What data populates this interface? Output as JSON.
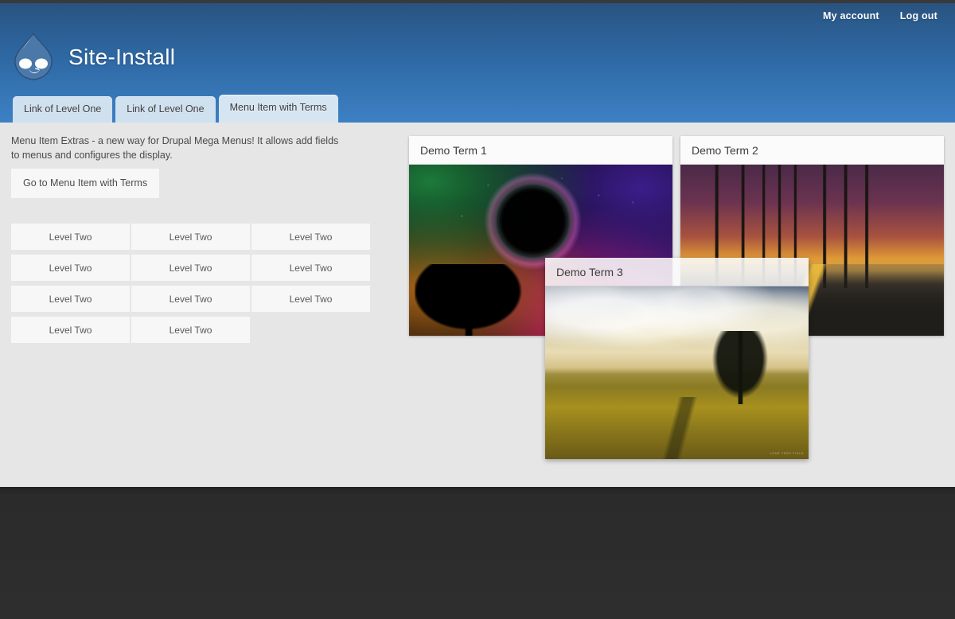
{
  "header": {
    "site_name": "Site-Install",
    "logo_icon": "drupal-droplet-icon",
    "account_links": [
      {
        "label": "My account"
      },
      {
        "label": "Log out"
      }
    ],
    "tabs": [
      {
        "label": "Link of Level One",
        "active": false
      },
      {
        "label": "Link of Level One",
        "active": false
      },
      {
        "label": "Menu Item with Terms",
        "active": true
      }
    ],
    "gradient_top": "#29537f",
    "gradient_bottom": "#3c80c4"
  },
  "main": {
    "intro_text": "Menu Item Extras - a new way for Drupal Mega Menus! It allows add fields to menus and configures the display.",
    "cta_label": "Go to Menu Item with Terms",
    "level_items": [
      {
        "label": "Level Two"
      },
      {
        "label": "Level Two"
      },
      {
        "label": "Level Two"
      },
      {
        "label": "Level Two"
      },
      {
        "label": "Level Two"
      },
      {
        "label": "Level Two"
      },
      {
        "label": "Level Two"
      },
      {
        "label": "Level Two"
      },
      {
        "label": "Level Two"
      },
      {
        "label": "Level Two"
      },
      {
        "label": "Level Two"
      }
    ],
    "term_cards": [
      {
        "title": "Demo Term 1",
        "image_alt": "eclipse-galaxy-tree-image"
      },
      {
        "title": "Demo Term 2",
        "image_alt": "palm-trees-sunset-road-image"
      },
      {
        "title": "Demo Term 3",
        "image_alt": "lone-tree-wheat-field-image",
        "watermark": "LONE TREE FIELD"
      }
    ]
  },
  "colors": {
    "page_background": "#e6e6e6",
    "footer_background": "#2e2e2e",
    "card_background": "#fbfbfb",
    "tab_background": "#cfe0ef"
  }
}
